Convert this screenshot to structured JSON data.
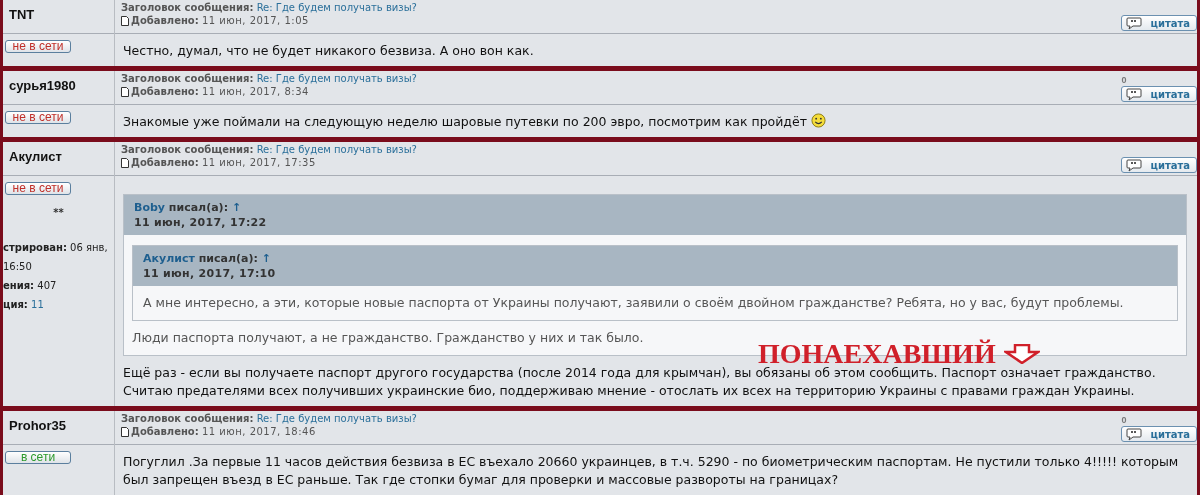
{
  "posts": [
    {
      "author": "TNT",
      "status": {
        "label": "не в сети",
        "online": false
      },
      "subject_label": "Заголовок сообщения:",
      "subject": "Re: Где будем получать визы?",
      "date_label": "Добавлено:",
      "date": "11 июн, 2017, 1:05",
      "quote_button": "цитата",
      "body": [
        {
          "kind": "text",
          "text": "Честно, думал, что не будет никакого безвиза. А оно вон как."
        }
      ]
    },
    {
      "author": "сурья1980",
      "status": {
        "label": "не в сети",
        "online": false
      },
      "subject_label": "Заголовок сообщения:",
      "subject": "Re: Где будем получать визы?",
      "date_label": "Добавлено:",
      "date": "11 июн, 2017, 8:34",
      "counter": "0",
      "quote_button": "цитата",
      "body": [
        {
          "kind": "text",
          "text": "Знакомые уже поймали на следующую неделю шаровые путевки по 200 эвро, посмотрим как пройдёт",
          "smiley": true
        }
      ]
    },
    {
      "author": "Акулист",
      "status": {
        "label": "не в сети",
        "online": false
      },
      "rank": "**",
      "profile": [
        {
          "label": "стрирован:",
          "value": "06 янв,"
        },
        {
          "value": "16:50"
        },
        {
          "label": "ения:",
          "value": "407"
        },
        {
          "label": "ция:",
          "value": "11",
          "link": true
        }
      ],
      "subject_label": "Заголовок сообщения:",
      "subject": "Re: Где будем получать визы?",
      "date_label": "Добавлено:",
      "date": "11 июн, 2017, 17:35",
      "quote_button": "цитата",
      "body": [
        {
          "kind": "quote",
          "author": "Boby",
          "wrote": "писал(а):",
          "arrow": "↑",
          "date": "11 июн, 2017, 17:22",
          "children": [
            {
              "kind": "quote",
              "author": "Акулист",
              "wrote": "писал(а):",
              "arrow": "↑",
              "date": "11 июн, 2017, 17:10",
              "children": [
                {
                  "kind": "text",
                  "text": "А мне интересно, а эти, которые новые паспорта от Украины получают, заявили о своём двойном гражданстве? Ребята, но у вас, будут проблемы."
                }
              ]
            },
            {
              "kind": "text",
              "text": "Люди паспорта получают, а не гражданство. Гражданство у них и так было."
            }
          ]
        },
        {
          "kind": "text",
          "text": "Ещё раз - если вы получаете паспорт другого государства (после 2014 года для крымчан), вы обязаны об этом сообщить. Паспорт означает гражданство. Считаю предателями всех получивших украинские био, поддерживаю мнение - отослать их всех на территорию Украины с правами граждан Украины."
        }
      ],
      "annotation": {
        "text": "ПОНАЕХАВШИЙ"
      }
    },
    {
      "author": "Prohor35",
      "status": {
        "label": "в сети",
        "online": true
      },
      "subject_label": "Заголовок сообщения:",
      "subject": "Re: Где будем получать визы?",
      "date_label": "Добавлено:",
      "date": "11 июн, 2017, 18:46",
      "counter": "0",
      "quote_button": "цитата",
      "body": [
        {
          "kind": "text",
          "text": "Погуглил .За первые 11 часов действия безвиза в ЕС въехало 20660 украинцев, в т.ч. 5290 - по биометрическим паспортам. Не пустили только 4!!!!! которым был запрещен въезд в ЕС раньше. Так где стопки бумаг для проверки и массовые развороты на границах?"
        }
      ]
    }
  ]
}
